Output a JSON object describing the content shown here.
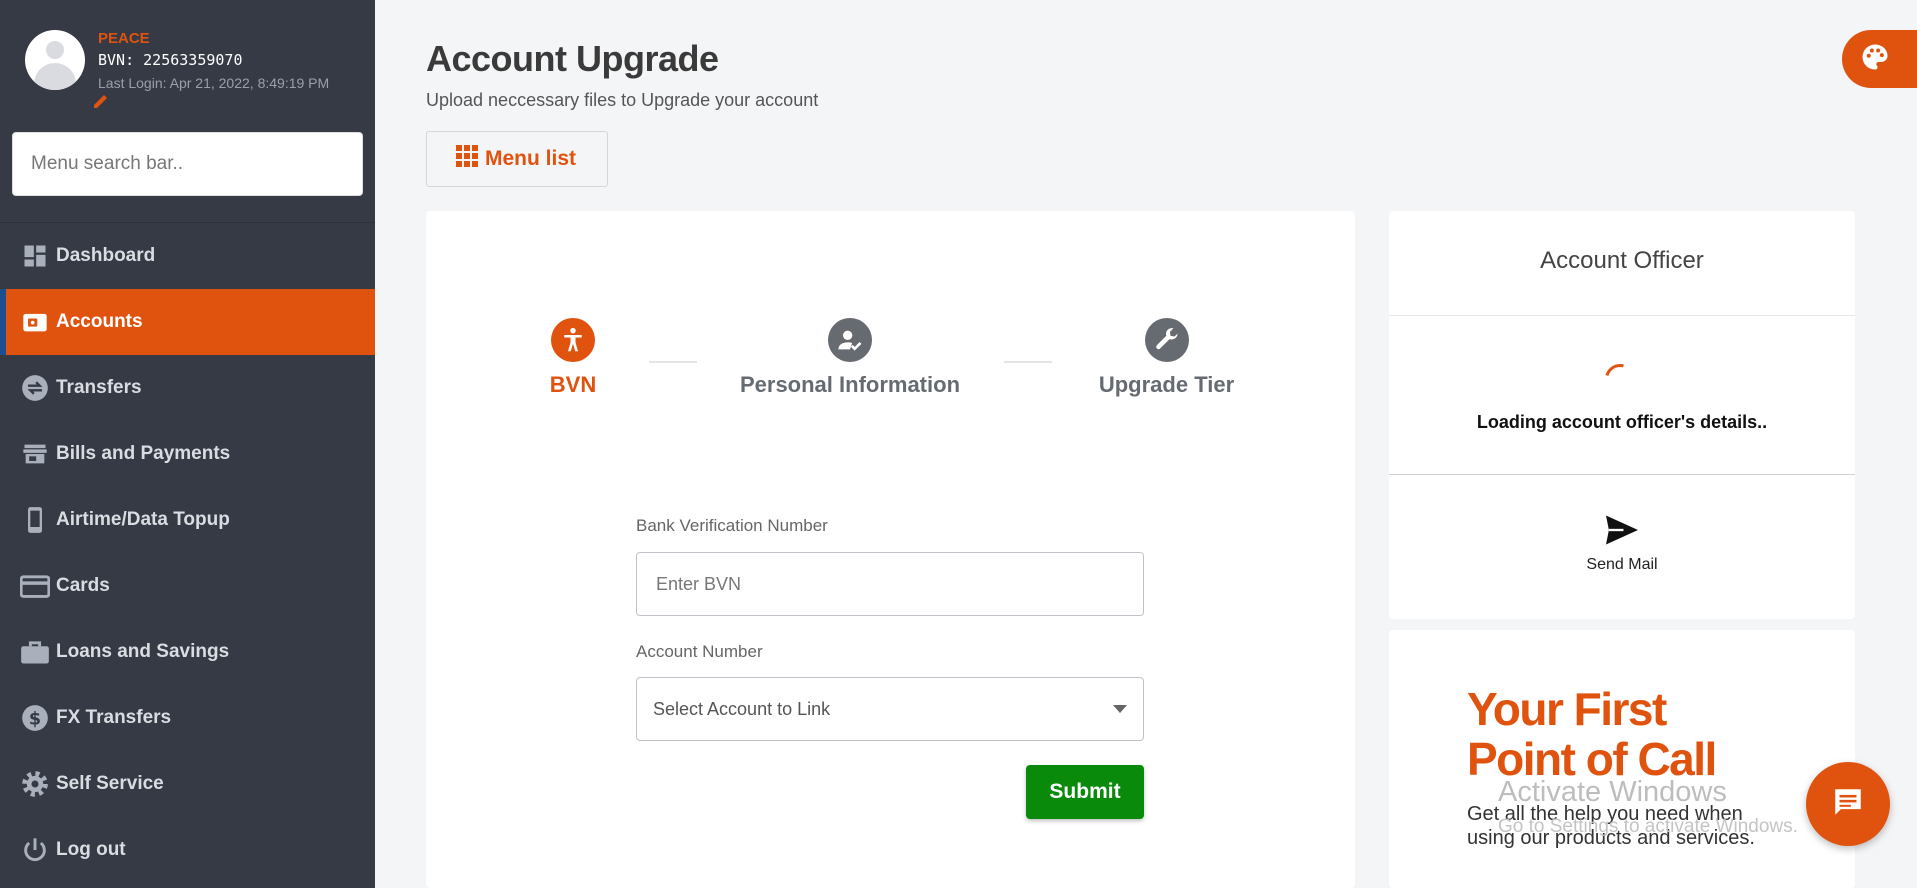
{
  "profile": {
    "name": "PEACE",
    "bvn_line": "BVN: 22563359070",
    "last_login": "Last Login: Apr 21, 2022, 8:49:19 PM"
  },
  "search": {
    "placeholder": "Menu search bar.."
  },
  "nav": {
    "items": [
      {
        "label": "Dashboard",
        "icon": "dashboard-icon"
      },
      {
        "label": "Accounts",
        "icon": "wallet-icon",
        "active": true
      },
      {
        "label": "Transfers",
        "icon": "transfer-icon"
      },
      {
        "label": "Bills and Payments",
        "icon": "store-icon"
      },
      {
        "label": "Airtime/Data Topup",
        "icon": "phone-icon"
      },
      {
        "label": "Cards",
        "icon": "card-icon"
      },
      {
        "label": "Loans and Savings",
        "icon": "briefcase-icon"
      },
      {
        "label": "FX Transfers",
        "icon": "dollar-icon"
      },
      {
        "label": "Self Service",
        "icon": "gear-icon"
      },
      {
        "label": "Log out",
        "icon": "power-icon"
      }
    ]
  },
  "page": {
    "title": "Account Upgrade",
    "subtitle": "Upload neccessary files to Upgrade your account",
    "menu_button": "Menu list"
  },
  "steps": [
    {
      "label": "BVN",
      "icon": "accessibility-icon",
      "active": true
    },
    {
      "label": "Personal Information",
      "icon": "user-check-icon",
      "active": false
    },
    {
      "label": "Upgrade Tier",
      "icon": "wrench-icon",
      "active": false
    }
  ],
  "form": {
    "bvn_label": "Bank Verification Number",
    "bvn_placeholder": "Enter BVN",
    "account_label": "Account Number",
    "account_selected": "Select Account to Link",
    "submit": "Submit"
  },
  "officer": {
    "title": "Account Officer",
    "loading": "Loading account officer's details..",
    "send_mail": "Send Mail"
  },
  "promo": {
    "headline_line1": "Your First",
    "headline_line2": "Point of Call",
    "text": "Get all the help you need when using our products and services."
  },
  "watermark": {
    "line1": "Activate Windows",
    "line2": "Go to Settings to activate Windows."
  },
  "colors": {
    "accent": "#e0530f",
    "sidebar": "#353a45",
    "submit": "#0a8a0a",
    "inactive_step": "#666b72"
  }
}
